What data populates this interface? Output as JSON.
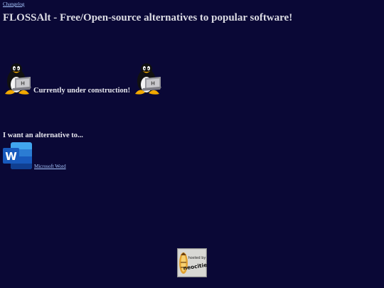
{
  "header": {
    "changelog_link": "Changelog",
    "title": "FLOSSAlt - Free/Open-source alternatives to popular software!"
  },
  "status": {
    "construction_text": "Currently under construction!",
    "left_icon": "tux-laptop-icon",
    "right_icon": "tux-laptop-icon"
  },
  "alternatives": {
    "heading": "I want an alternative to...",
    "items": [
      {
        "label": "Microsoft Word",
        "icon": "microsoft-word-icon"
      }
    ]
  },
  "footer": {
    "badge_icon": "neocities-badge-icon",
    "badge_text": "neocities"
  },
  "colors": {
    "background": "#0a0836",
    "link": "#a8c8ff",
    "text": "#e6e6ee",
    "word_blue": "#2b5cb8"
  }
}
